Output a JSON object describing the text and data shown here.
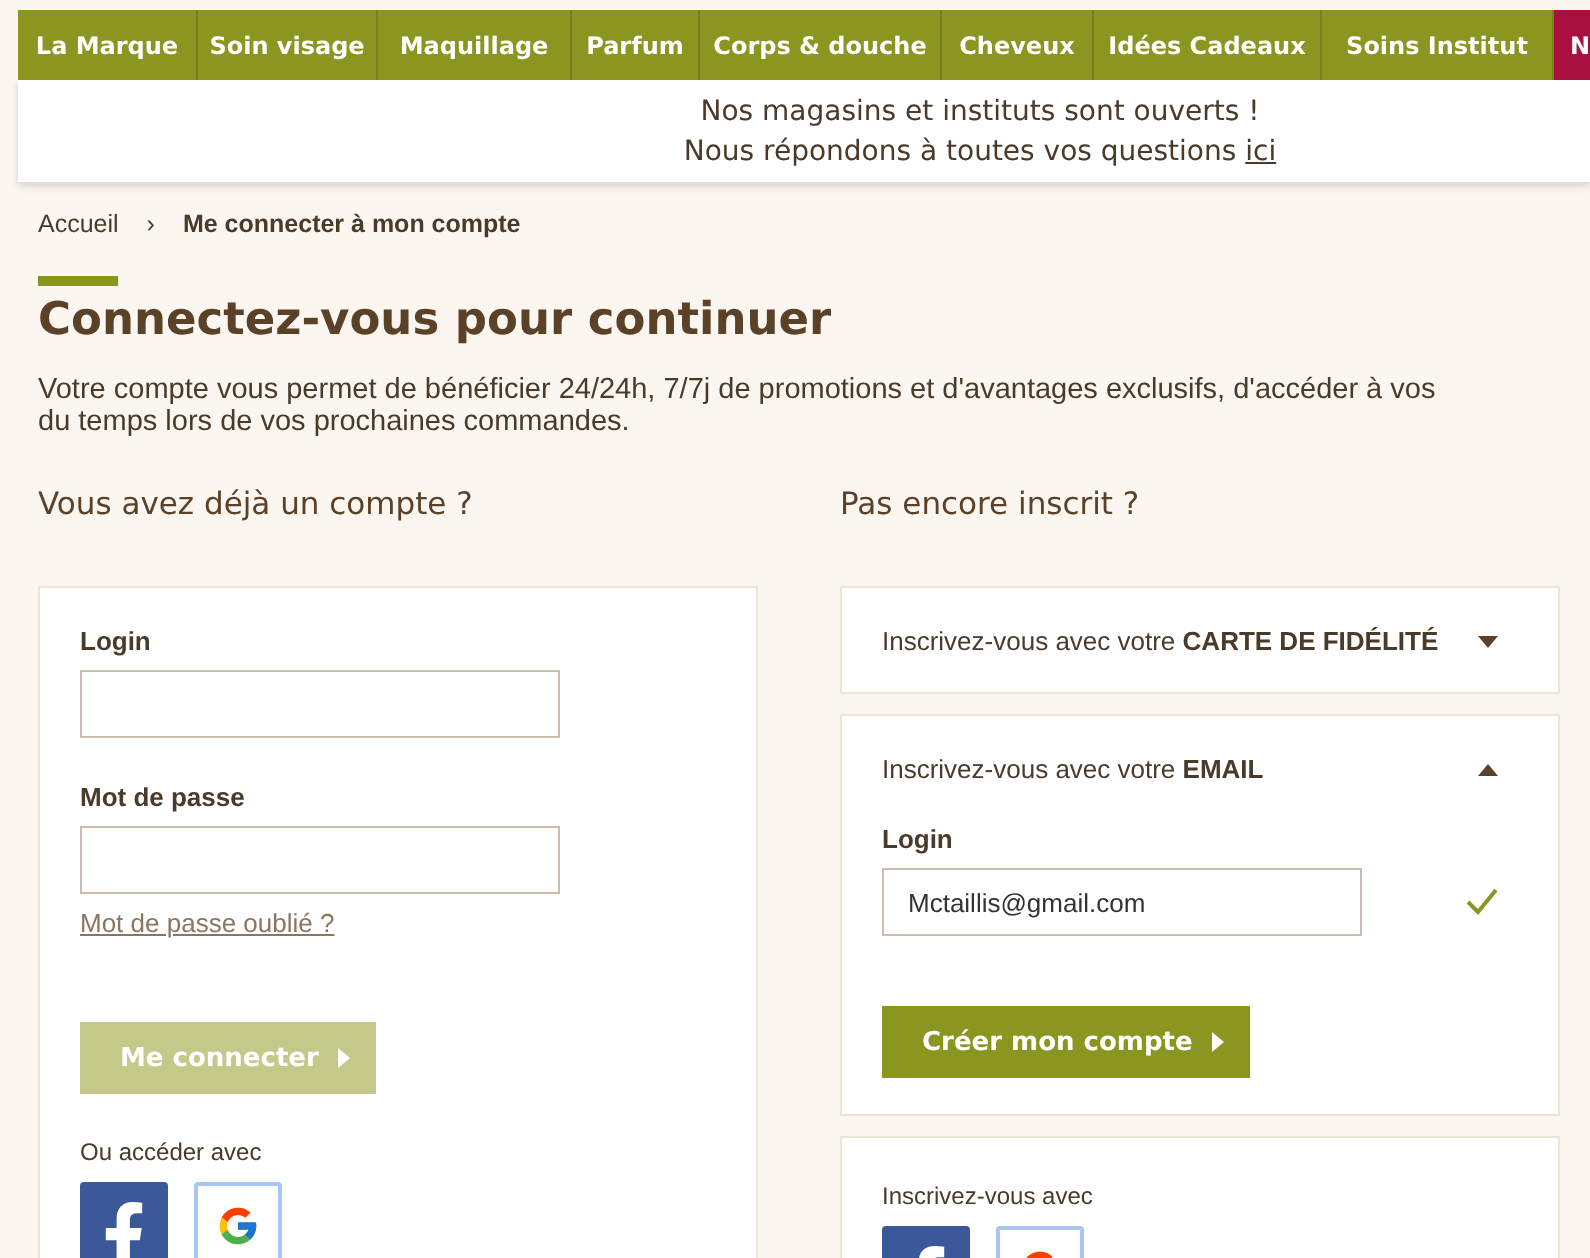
{
  "nav": [
    {
      "label": "La Marque",
      "kind": "normal"
    },
    {
      "label": "Soin visage",
      "kind": "normal"
    },
    {
      "label": "Maquillage",
      "kind": "normal"
    },
    {
      "label": "Parfum",
      "kind": "normal"
    },
    {
      "label": "Corps & douche",
      "kind": "normal"
    },
    {
      "label": "Cheveux",
      "kind": "normal"
    },
    {
      "label": "Idées Cadeaux",
      "kind": "normal"
    },
    {
      "label": "Soins Institut",
      "kind": "normal"
    },
    {
      "label": "N",
      "kind": "highlight"
    }
  ],
  "banner": {
    "title": "Nos magasins et instituts sont ouverts !",
    "text": "Nous répondons à toutes vos questions",
    "link": "ici"
  },
  "breadcrumb": [
    {
      "label": "Accueil",
      "current": false
    },
    {
      "label": "Me connecter à mon compte",
      "current": true
    }
  ],
  "separator": "›",
  "title": "Connectez-vous pour continuer",
  "description_lines": [
    "Votre compte vous permet de bénéficier 24/24h, 7/7j de promotions et d'avantages exclusifs, d'accéder à vos",
    "du temps lors de vos prochaines commandes."
  ],
  "login": {
    "heading": "Vous avez déjà un compte ?",
    "fields": [
      {
        "label": "Login"
      },
      {
        "label": "Mot de passe"
      }
    ],
    "forgot": "Mot de passe oublié ?",
    "button": {
      "label": "Me connecter",
      "disabled": true
    },
    "social_label": "Ou accéder avec"
  },
  "register": {
    "heading": "Pas encore inscrit ?",
    "panels": [
      {
        "prefix": "Inscrivez-vous avec votre",
        "strong": "CARTE DE FIDÉLITÉ",
        "expanded": false
      },
      {
        "prefix": "Inscrivez-vous avec votre",
        "strong": "EMAIL",
        "expanded": true
      }
    ],
    "field": {
      "label": "Login",
      "value": "Mctaillis@gmail.com",
      "valid": true
    },
    "button": {
      "label": "Créer mon compte",
      "disabled": false
    },
    "social_label": "Inscrivez-vous avec"
  }
}
